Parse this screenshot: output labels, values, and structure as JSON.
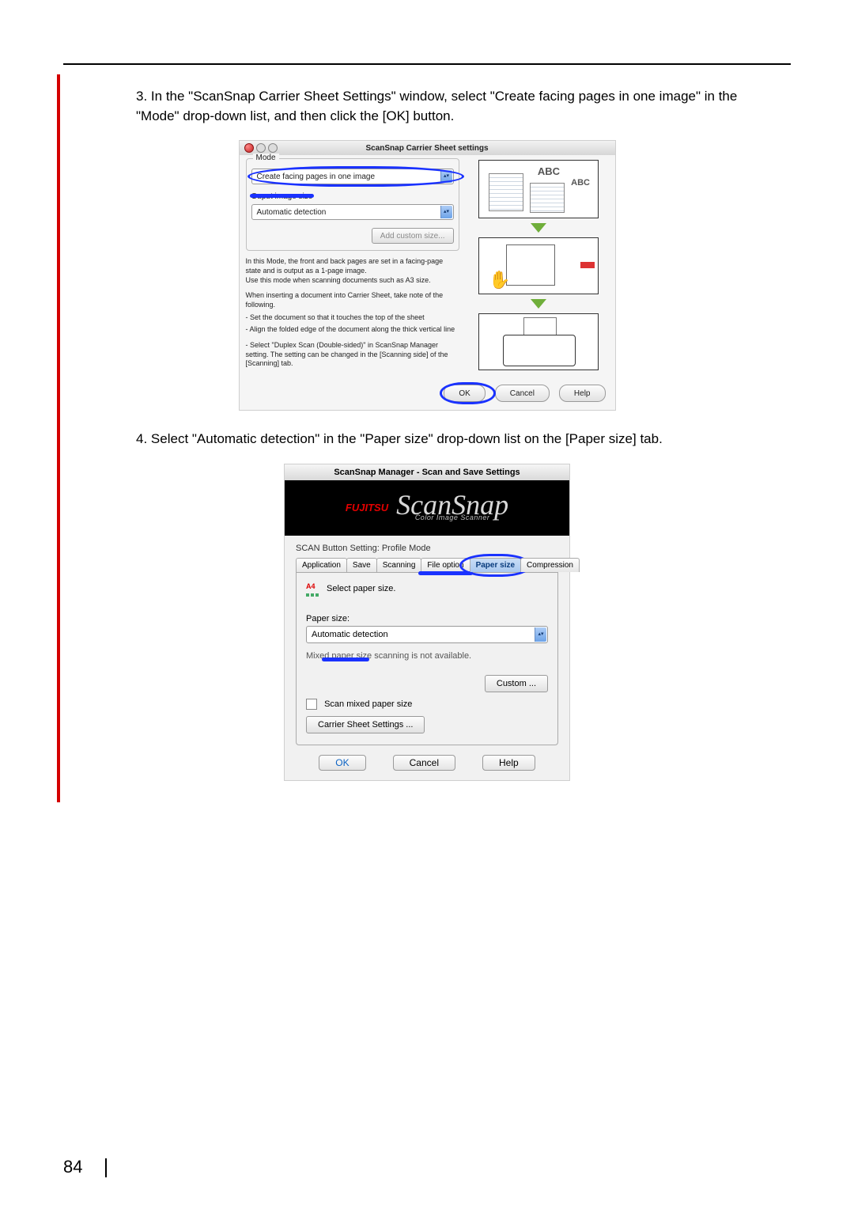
{
  "page_number": "84",
  "step3": {
    "number": "3.",
    "text": "In the \"ScanSnap Carrier Sheet Settings\" window, select \"Create facing pages in one image\" in the \"Mode\" drop-down list, and then click the [OK] button."
  },
  "step4": {
    "number": "4.",
    "text": "Select \"Automatic detection\" in the \"Paper size\" drop-down list on the [Paper size] tab."
  },
  "dlg1": {
    "title": "ScanSnap Carrier Sheet settings",
    "mode_group": "Mode",
    "mode_value": "Create facing pages in one image",
    "output_label": "Ouput image size",
    "output_value": "Automatic detection",
    "add_custom": "Add custom size...",
    "info1": "In this Mode, the front and back pages are set in a facing-page state and is output as a 1-page image.\nUse this mode when scanning documents such as A3 size.",
    "info2": "When inserting a document into Carrier Sheet, take note of the following.",
    "info3a": "- Set the document so that it touches the top of the sheet",
    "info3b": "- Align the folded edge of the document along the thick vertical line",
    "info4": "- Select \"Duplex Scan (Double-sided)\" in ScanSnap Manager setting.  The setting can be changed in the [Scanning side] of the [Scanning] tab.",
    "ok": "OK",
    "cancel": "Cancel",
    "help": "Help",
    "abc_a": "ABC",
    "abc_b": "ABC"
  },
  "dlg2": {
    "title": "ScanSnap Manager - Scan and Save Settings",
    "brand_small": "FUJITSU",
    "brand_big": "ScanSnap",
    "brand_sub": "Color Image Scanner",
    "profile_mode": "SCAN Button Setting: Profile Mode",
    "tabs": {
      "application": "Application",
      "save": "Save",
      "scanning": "Scanning",
      "file_option": "File option",
      "paper_size": "Paper size",
      "compression": "Compression"
    },
    "select_paper": "Select paper size.",
    "paper_size_label": "Paper size:",
    "paper_size_value": "Automatic detection",
    "mixed_na": "Mixed paper size scanning is not available.",
    "custom": "Custom ...",
    "scan_mixed": "Scan mixed paper size",
    "carrier_btn": "Carrier Sheet Settings ...",
    "ok": "OK",
    "cancel": "Cancel",
    "help": "Help"
  }
}
